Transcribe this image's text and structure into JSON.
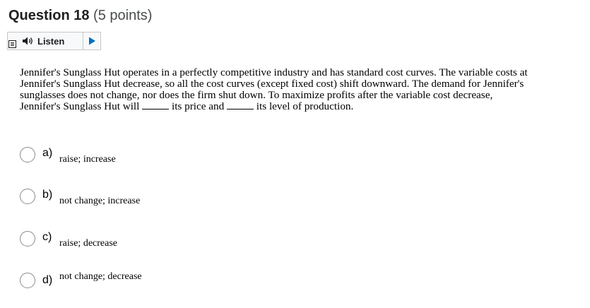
{
  "question": {
    "title": "Question 18",
    "points": "(5 points)",
    "text_before_blank1": "Jennifer's Sunglass Hut operates in a perfectly competitive industry and has standard cost curves. The variable costs at Jennifer's Sunglass Hut decrease, so all the cost curves (except fixed cost) shift downward. The demand for Jennifer's sunglasses does not change, nor does the firm shut down. To maximize profits after the variable cost decrease, Jennifer's Sunglass Hut will ",
    "text_between_blanks": " its price and ",
    "text_after_blank2": " its level of production."
  },
  "listen": {
    "label": "Listen",
    "menu_icon": "menu-icon",
    "speaker_icon": "speaker-icon",
    "play_icon": "play-icon"
  },
  "options": [
    {
      "letter": "a)",
      "text": "raise; increase"
    },
    {
      "letter": "b)",
      "text": "not change; increase"
    },
    {
      "letter": "c)",
      "text": "raise; decrease"
    },
    {
      "letter": "d)",
      "text": "not change; decrease"
    }
  ],
  "colors": {
    "title": "#202122",
    "points": "#494c4e",
    "radio_border": "#868c8f",
    "listen_border": "#c4c7ca",
    "listen_bg": "#f8f9fa",
    "play": "#006fbf"
  }
}
